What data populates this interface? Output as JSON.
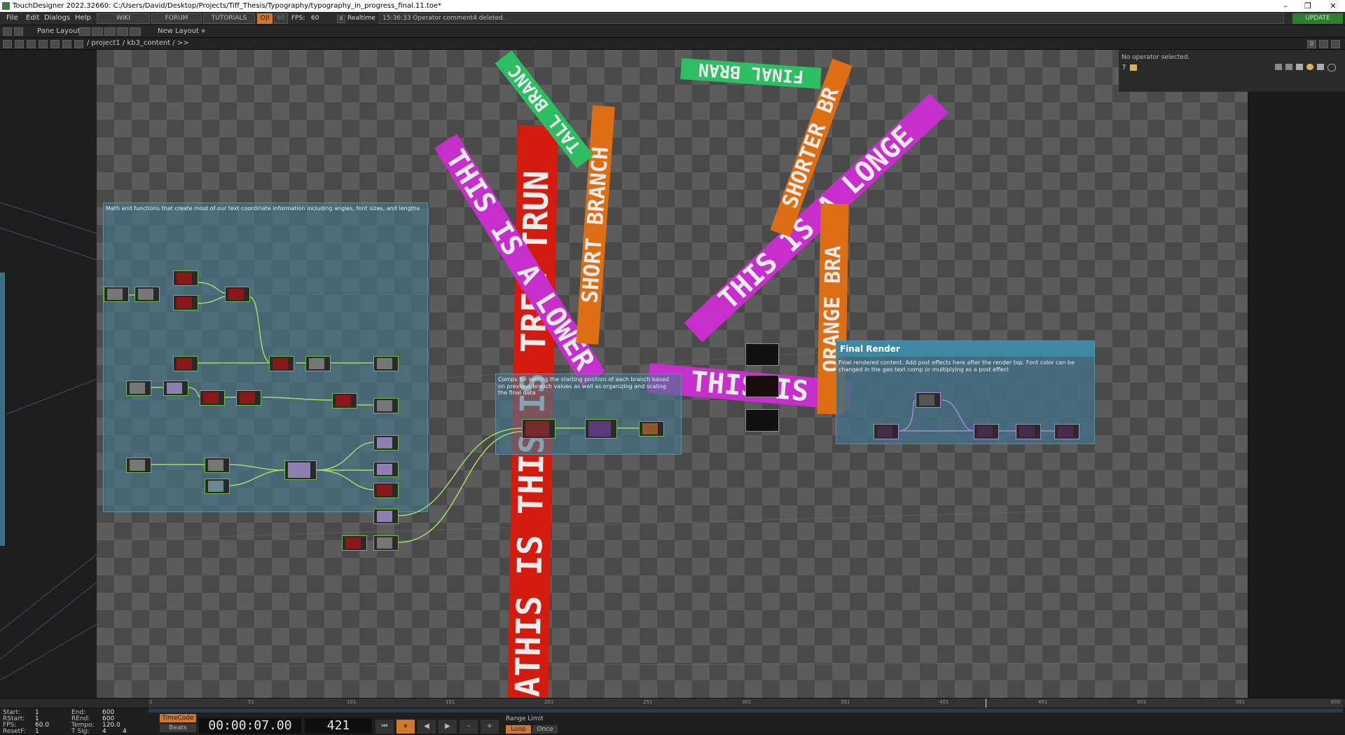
{
  "window": {
    "title": "TouchDesigner 2022.32660: C:/Users/David/Desktop/Projects/Tiff_Thesis/Typography/typography_in_progress_final.11.toe*",
    "minimize": "–",
    "maximize": "❐",
    "close": "✕"
  },
  "menubar": {
    "menus": [
      "File",
      "Edit",
      "Dialogs",
      "Help"
    ],
    "wiki": "WIKI",
    "forum": "FORUM",
    "tutorials": "TUTORIALS",
    "oi": "O|I",
    "fps_cap": "60",
    "fps_label": "FPS:",
    "fps_value": "60",
    "realtime_check": "X",
    "realtime_label": "Realtime",
    "status": "15:36:33 Operator comment4 deleted.",
    "update": "UPDATE"
  },
  "panebar": {
    "pane_layout": "Pane Layout",
    "new_layout": "New Layout",
    "add": "+"
  },
  "pathbar": {
    "path": "/ project1 / kb3_content / >>",
    "zero": "0"
  },
  "network": {
    "no_operator": "No operator selected.",
    "help_icon": "?",
    "comps": {
      "math": "Math and functions that create most of our text coordinate information including angles, font sizes, and lengths",
      "branch": "Comps for setting the starting position of each branch based on previous branch values as well as organizing and scaling the final data",
      "final_title": "Final Render",
      "final_text": "Final rendered content. Add post effects here after the render top. Font color can be changed in the geo text comp or multiplying as a post effect"
    },
    "bands": [
      {
        "text": "ATHIS IS THIS IS TREE TRUN",
        "color": "#d41b10"
      },
      {
        "text": "THIS IS A LONGE",
        "color": "#c72fcc"
      },
      {
        "text": "THIS IS A LOWER",
        "color": "#c72fcc"
      },
      {
        "text": "THIS IS",
        "color": "#c72fcc"
      },
      {
        "text": "SHORT BRANCH",
        "color": "#de6e14"
      },
      {
        "text": "SHORTER BR",
        "color": "#de6e14"
      },
      {
        "text": "ORANGE BRA",
        "color": "#de6e14"
      },
      {
        "text": "TALL BRANC",
        "color": "#2dbd62"
      },
      {
        "text": "FINAL BRAN",
        "color": "#2dbd62"
      }
    ]
  },
  "timeline": {
    "ticks": [
      "1",
      "51",
      "101",
      "151",
      "201",
      "251",
      "301",
      "351",
      "401",
      "451",
      "501",
      "551",
      "600"
    ]
  },
  "bottom": {
    "start_label": "Start:",
    "start": "1",
    "end_label": "End:",
    "end": "600",
    "rstart_label": "RStart:",
    "rstart": "1",
    "rend_label": "REnd:",
    "rend": "600",
    "fps_label": "FPS:",
    "fps": "60.0",
    "tempo_label": "Tempo:",
    "tempo": "120.0",
    "resetf_label": "ResetF:",
    "resetf": "1",
    "tsig_label": "T Sig:",
    "tsig_a": "4",
    "tsig_b": "4",
    "timecode": "TimeCode",
    "beats": "Beats",
    "time": "00:00:07.00",
    "frame": "421",
    "range_limit": "Range Limit",
    "loop": "Loop",
    "once": "Once",
    "btn_start": "⏮",
    "btn_pause": "⏸",
    "btn_back": "◀",
    "btn_fwd": "▶",
    "btn_minus": "-",
    "btn_plus": "+"
  }
}
